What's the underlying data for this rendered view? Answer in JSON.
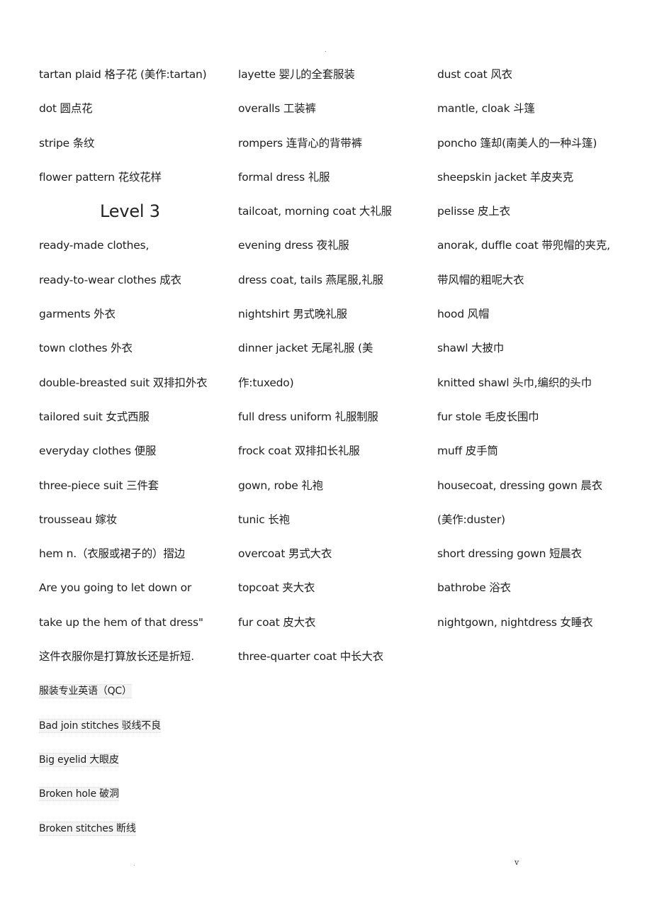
{
  "page": {
    "top_mark": ".",
    "footer_left": ".",
    "footer_right": "v"
  },
  "columns": [
    {
      "entries": [
        {
          "type": "term",
          "text": "tartan plaid  格子花  (美作:tartan)"
        },
        {
          "type": "term",
          "text": "dot  圆点花"
        },
        {
          "type": "term",
          "text": "stripe  条纹"
        },
        {
          "type": "term",
          "text": "flower pattern  花纹花样"
        },
        {
          "type": "heading",
          "text": "Level 3"
        },
        {
          "type": "term",
          "text": "ready-made clothes,"
        },
        {
          "type": "term",
          "text": "ready-to-wear clothes  成衣"
        },
        {
          "type": "term",
          "text": "garments  外衣"
        },
        {
          "type": "term",
          "text": "town clothes  外衣"
        },
        {
          "type": "term",
          "text": "double-breasted suit  双排扣外衣"
        },
        {
          "type": "term",
          "text": "tailored suit  女式西服"
        },
        {
          "type": "term",
          "text": "everyday clothes  便服"
        },
        {
          "type": "term",
          "text": "three-piece suit  三件套"
        },
        {
          "type": "term",
          "text": "trousseau  嫁妆"
        },
        {
          "type": "term",
          "text": "hem n.（衣服或裙子的）摺边"
        },
        {
          "type": "term",
          "text": "Are you going to let down or"
        },
        {
          "type": "term",
          "text": "take up the hem of that dress\""
        },
        {
          "type": "term",
          "text": "这件衣服你是打算放长还是折短."
        },
        {
          "type": "qc",
          "text": "服装专业英语（QC）"
        },
        {
          "type": "qc",
          "text": "Bad join stitches  驳线不良"
        },
        {
          "type": "qc",
          "text": "Big eyelid  大眼皮"
        },
        {
          "type": "qc",
          "text": "Broken hole  破洞"
        },
        {
          "type": "qc",
          "text": "Broken stitches  断线"
        }
      ]
    },
    {
      "entries": [
        {
          "type": "term",
          "text": "layette  婴儿的全套服装"
        },
        {
          "type": "term",
          "text": "overalls  工装裤"
        },
        {
          "type": "term",
          "text": "rompers  连背心的背带裤"
        },
        {
          "type": "term",
          "text": "formal dress  礼服"
        },
        {
          "type": "term",
          "text": "tailcoat, morning coat  大礼服"
        },
        {
          "type": "term",
          "text": "evening dress  夜礼服"
        },
        {
          "type": "term",
          "text": "dress coat, tails  燕尾服,礼服"
        },
        {
          "type": "term",
          "text": "nightshirt  男式晚礼服"
        },
        {
          "type": "term",
          "text": "dinner jacket  无尾礼服  (美"
        },
        {
          "type": "term",
          "text": "作:tuxedo)"
        },
        {
          "type": "term",
          "text": "full dress uniform  礼服制服"
        },
        {
          "type": "term",
          "text": "frock coat  双排扣长礼服"
        },
        {
          "type": "term",
          "text": "gown, robe  礼袍"
        },
        {
          "type": "term",
          "text": "tunic  长袍"
        },
        {
          "type": "term",
          "text": "overcoat  男式大衣"
        },
        {
          "type": "term",
          "text": "topcoat  夹大衣"
        },
        {
          "type": "term",
          "text": "fur coat  皮大衣"
        },
        {
          "type": "term",
          "text": "three-quarter coat  中长大衣"
        }
      ]
    },
    {
      "entries": [
        {
          "type": "term",
          "text": "dust coat  风衣"
        },
        {
          "type": "term",
          "text": "mantle, cloak  斗篷"
        },
        {
          "type": "term",
          "text": "poncho  篷却(南美人的一种斗篷)"
        },
        {
          "type": "term",
          "text": "sheepskin jacket  羊皮夹克"
        },
        {
          "type": "term",
          "text": "pelisse  皮上衣"
        },
        {
          "type": "term",
          "text": "anorak, duffle coat  带兜帽的夹克,"
        },
        {
          "type": "term",
          "text": "带风帽的粗呢大衣"
        },
        {
          "type": "term",
          "text": "hood  风帽"
        },
        {
          "type": "term",
          "text": "shawl  大披巾"
        },
        {
          "type": "term",
          "text": "knitted shawl  头巾,编织的头巾"
        },
        {
          "type": "term",
          "text": "fur stole  毛皮长围巾"
        },
        {
          "type": "term",
          "text": "muff  皮手筒"
        },
        {
          "type": "term",
          "text": "housecoat, dressing gown  晨衣"
        },
        {
          "type": "term",
          "text": "(美作:duster)"
        },
        {
          "type": "term",
          "text": "short dressing gown  短晨衣"
        },
        {
          "type": "term",
          "text": "bathrobe  浴衣"
        },
        {
          "type": "term",
          "text": "nightgown, nightdress  女睡衣"
        }
      ]
    }
  ]
}
